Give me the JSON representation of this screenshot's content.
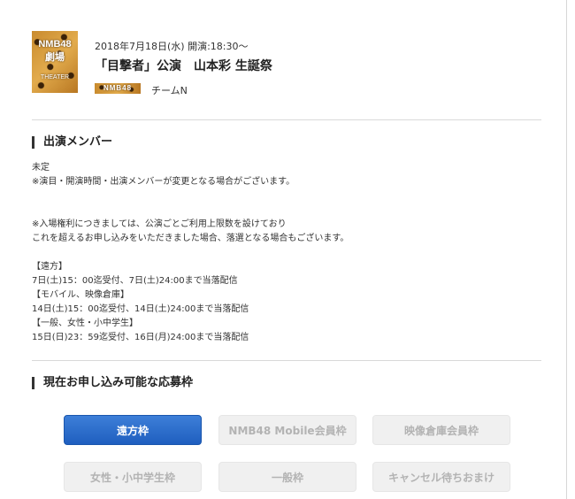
{
  "event": {
    "logo_text": [
      "NMB48",
      "劇場",
      "THEATER"
    ],
    "date_time": "2018年7月18日(水) 開演:18:30～",
    "title": "「目撃者」公演　山本彩 生誕祭",
    "team_badge": "NMB48",
    "team": "チームN"
  },
  "members_section": {
    "heading": "出演メンバー",
    "status": "未定",
    "change_notice": "※演目・開演時間・出演メンバーが変更となる場合がございます。",
    "entry_notice_1": "※入場権利につきましては、公演ごとご利用上限数を設けており",
    "entry_notice_2": "これを超えるお申し込みをいただきました場合、落選となる場合もございます。",
    "schedule": [
      {
        "label": "【遠方】",
        "detail": "7日(土)15：00迄受付、7日(土)24:00まで当落配信"
      },
      {
        "label": "【モバイル、映像倉庫】",
        "detail": "14日(土)15：00迄受付、14日(土)24:00まで当落配信"
      },
      {
        "label": "【一般、女性・小中学生】",
        "detail": "15日(日)23：59迄受付、16日(月)24:00まで当落配信"
      }
    ]
  },
  "application_section": {
    "heading": "現在お申し込み可能な応募枠",
    "buttons": [
      {
        "label": "遠方枠",
        "state": "active"
      },
      {
        "label": "NMB48 Mobile会員枠",
        "state": "disabled"
      },
      {
        "label": "映像倉庫会員枠",
        "state": "disabled"
      },
      {
        "label": "女性・小中学生枠",
        "state": "disabled"
      },
      {
        "label": "一般枠",
        "state": "disabled"
      },
      {
        "label": "キャンセル待ちおまけ",
        "state": "disabled"
      }
    ]
  },
  "colors": {
    "active_button": "#2a6fcf",
    "disabled_button": "#f0f0f0",
    "disabled_text": "#b3b3b3",
    "divider": "#d9d9d9"
  }
}
